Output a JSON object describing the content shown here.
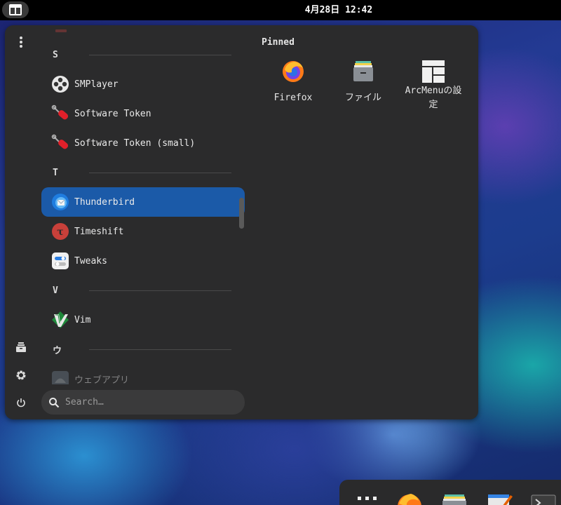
{
  "topbar": {
    "clock": "4月28日 12:42"
  },
  "menu": {
    "categories": [
      {
        "letter": "S"
      },
      {
        "letter": "T"
      },
      {
        "letter": "V"
      },
      {
        "letter": "ウ"
      }
    ],
    "apps": [
      {
        "name": "SMPlayer",
        "icon": "smplayer-icon"
      },
      {
        "name": "Software Token",
        "icon": "software-token-icon"
      },
      {
        "name": "Software Token (small)",
        "icon": "software-token-icon"
      },
      {
        "name": "Thunderbird",
        "icon": "thunderbird-icon",
        "selected": true
      },
      {
        "name": "Timeshift",
        "icon": "timeshift-icon"
      },
      {
        "name": "Tweaks",
        "icon": "tweaks-icon"
      },
      {
        "name": "Vim",
        "icon": "vim-icon"
      },
      {
        "name": "ウェブアプリ",
        "icon": "web-apps-icon"
      }
    ],
    "search_placeholder": "Search…",
    "pinned_title": "Pinned",
    "pinned": [
      {
        "label": "Firefox",
        "icon": "firefox-icon"
      },
      {
        "label": "ファイル",
        "icon": "files-icon"
      },
      {
        "label": "ArcMenuの設定",
        "icon": "arcmenu-settings-icon"
      }
    ]
  },
  "colors": {
    "selection": "#1b5aa8",
    "panel": "#2b2b2c",
    "topbar": "#000000"
  }
}
